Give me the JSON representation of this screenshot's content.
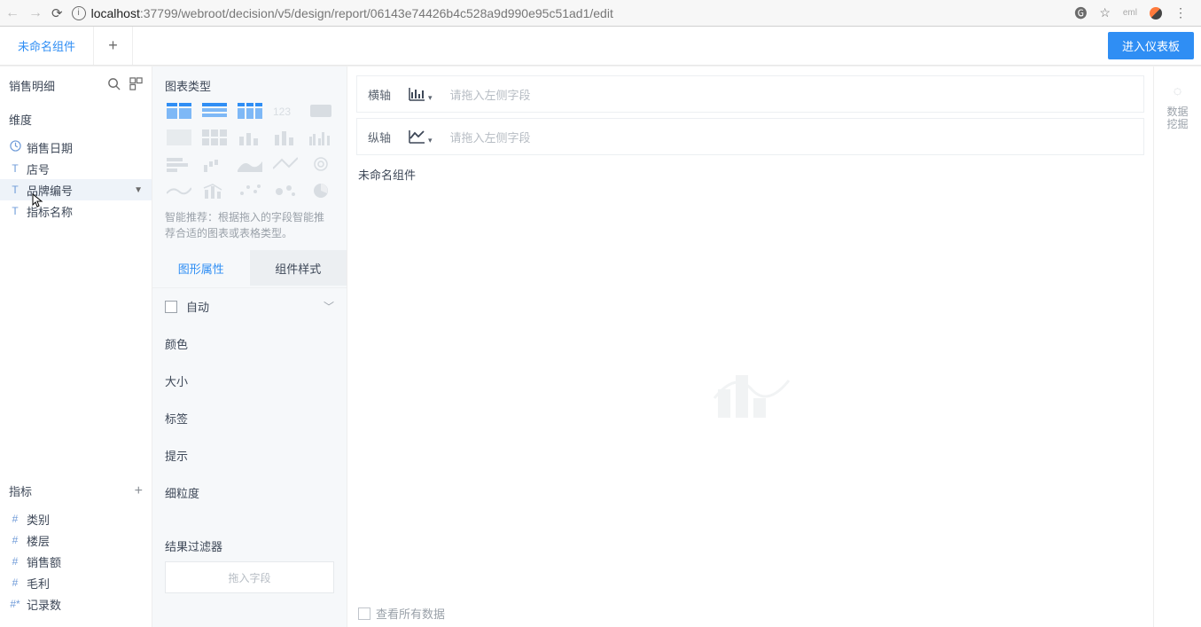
{
  "browser": {
    "url_host": "localhost",
    "url_path": ":37799/webroot/decision/v5/design/report/06143e74426b4c528a9d990e95c51ad1/edit"
  },
  "tabs": {
    "active": "未命名组件",
    "dashboard_btn": "进入仪表板"
  },
  "sidebar": {
    "dataset": "销售明细",
    "dim_title": "维度",
    "dims": [
      {
        "type": "clock",
        "label": "销售日期"
      },
      {
        "type": "T",
        "label": "店号"
      },
      {
        "type": "T",
        "label": "品牌编号",
        "hover": true
      },
      {
        "type": "T",
        "label": "指标名称"
      }
    ],
    "measure_title": "指标",
    "measures": [
      {
        "type": "#",
        "label": "类别"
      },
      {
        "type": "#",
        "label": "楼层"
      },
      {
        "type": "#",
        "label": "销售额"
      },
      {
        "type": "#",
        "label": "毛利"
      },
      {
        "type": "#*",
        "label": "记录数"
      }
    ]
  },
  "config": {
    "chart_type_title": "图表类型",
    "hint": "智能推荐：根据拖入的字段智能推荐合适的图表或表格类型。",
    "tabs": {
      "graph": "图形属性",
      "style": "组件样式"
    },
    "auto": "自动",
    "rows": {
      "color": "颜色",
      "size": "大小",
      "label": "标签",
      "tooltip": "提示",
      "granularity": "细粒度"
    },
    "result_filter": "结果过滤器",
    "drop_hint": "拖入字段"
  },
  "canvas": {
    "x_axis": "横轴",
    "y_axis": "纵轴",
    "axis_placeholder": "请拖入左侧字段",
    "component_name": "未命名组件",
    "show_all_data": "查看所有数据",
    "side": {
      "label1": "数据",
      "label2": "挖掘"
    }
  }
}
